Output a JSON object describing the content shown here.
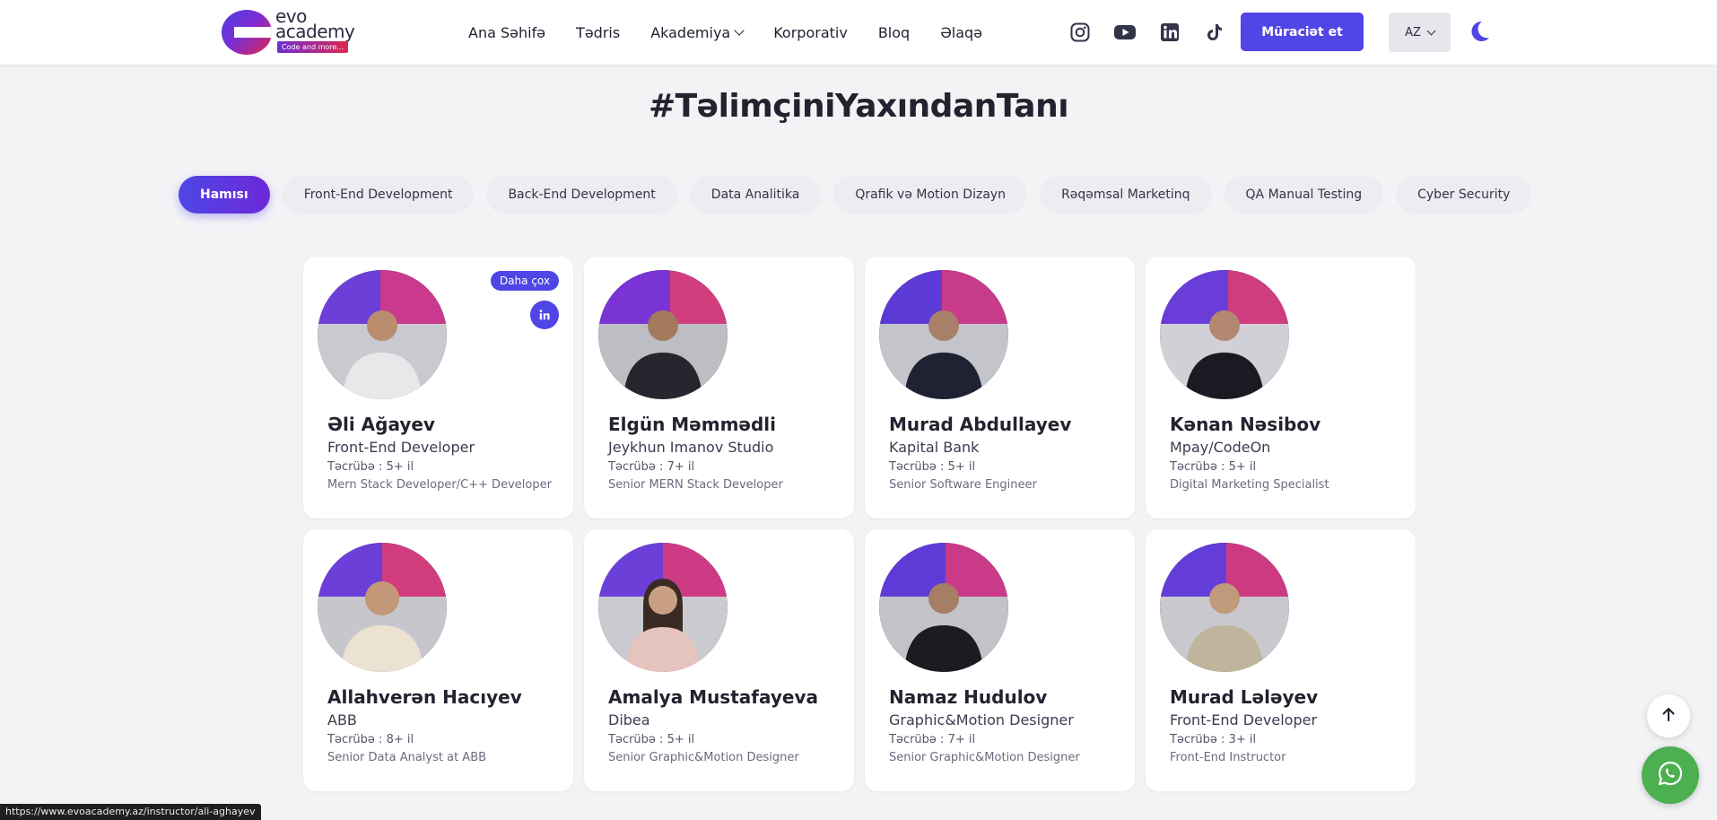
{
  "header": {
    "logo": {
      "line1": "evo",
      "line2": "academy",
      "tagline": "Code and more..."
    },
    "nav": [
      {
        "label": "Ana Səhifə"
      },
      {
        "label": "Tədris"
      },
      {
        "label": "Akademiya",
        "has_dropdown": true
      },
      {
        "label": "Korporativ"
      },
      {
        "label": "Bloq"
      },
      {
        "label": "Əlaqə"
      }
    ],
    "socials": [
      "instagram-icon",
      "youtube-icon",
      "linkedin-icon",
      "tiktok-icon"
    ],
    "cta_label": "Müraciət et",
    "language": "AZ",
    "theme_icon": "moon-icon"
  },
  "page_title": "#TəlimçiniYaxındanTanı",
  "filters": [
    {
      "label": "Hamısı",
      "active": true
    },
    {
      "label": "Front-End Development"
    },
    {
      "label": "Back-End Development"
    },
    {
      "label": "Data Analitika"
    },
    {
      "label": "Qrafik və Motion Dizayn"
    },
    {
      "label": "Rəqəmsal Marketinq"
    },
    {
      "label": "QA Manual Testing"
    },
    {
      "label": "Cyber Security"
    }
  ],
  "instructors": [
    {
      "name": "Əli Ağayev",
      "company": "Front-End Developer",
      "experience": "Təcrübə : 5+ il",
      "role": "Mern Stack Developer/C++ Developer",
      "badge": "Daha çox"
    },
    {
      "name": "Elgün Məmmədli",
      "company": "Jeykhun Imanov Studio",
      "experience": "Təcrübə : 7+ il",
      "role": "Senior MERN Stack Developer"
    },
    {
      "name": "Murad Abdullayev",
      "company": "Kapital Bank",
      "experience": "Təcrübə : 5+ il",
      "role": "Senior Software Engineer"
    },
    {
      "name": "Kənan Nəsibov",
      "company": "Mpay/CodeOn",
      "experience": "Təcrübə : 5+ il",
      "role": "Digital Marketing Specialist"
    },
    {
      "name": "Allahverən Hacıyev",
      "company": "ABB",
      "experience": "Təcrübə : 8+ il",
      "role": "Senior Data Analyst at ABB"
    },
    {
      "name": "Amalya Mustafayeva",
      "company": "Dibea",
      "experience": "Təcrübə : 5+ il",
      "role": "Senior Graphic&Motion Designer"
    },
    {
      "name": "Namaz Hudulov",
      "company": "Graphic&Motion Designer",
      "experience": "Təcrübə : 7+ il",
      "role": "Senior Graphic&Motion Designer"
    },
    {
      "name": "Murad Lələyev",
      "company": "Front-End Developer",
      "experience": "Təcrübə : 3+ il",
      "role": "Front-End Instructor"
    }
  ],
  "status_url": "https://www.evoacademy.az/instructor/ali-aghayev",
  "colors": {
    "accent": "#4f46e5",
    "whatsapp": "#4caf50",
    "page_bg": "#f3f3f6"
  }
}
